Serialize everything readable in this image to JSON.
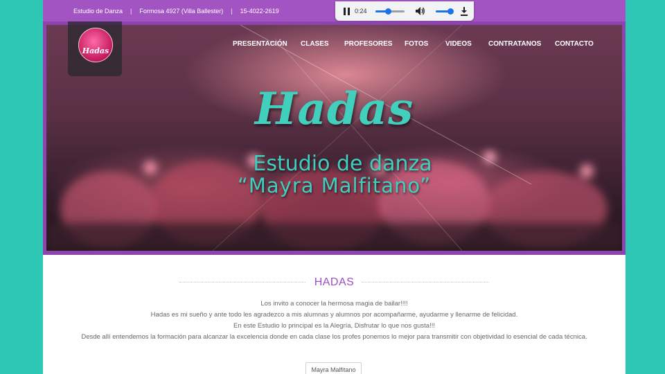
{
  "topbar": {
    "studio": "Estudio de Danza",
    "address": "Formosa 4927 (Villa Ballester)",
    "phone": "15-4022-2619",
    "separator": "|"
  },
  "audio_player": {
    "time": "0:24",
    "progress_fraction": 0.45,
    "volume_fraction": 1.0,
    "pause_icon": "pause-icon",
    "volume_icon": "volume-icon",
    "download_icon": "download-icon"
  },
  "logo": {
    "text": "Hadas"
  },
  "nav": {
    "items": [
      "PRESENTACIÓN",
      "CLASES",
      "PROFESORES",
      "FOTOS",
      "VIDEOS",
      "CONTRATANOS",
      "CONTACTO"
    ]
  },
  "hero": {
    "title": "Hadas",
    "subtitle_line1": "Estudio de danza",
    "subtitle_line2": "“Mayra Malfitano”"
  },
  "section": {
    "title": "HADAS",
    "paragraphs": [
      "Los invito a conocer la hermosa magia de bailar!!!!",
      "Hadas es mi sueño y ante todo les agradezco a mis alumnas y alumnos por acompañarme, ayudarme y llenarme de felicidad.",
      "En este Estudio lo principal es la Alegría, Disfrutar lo que nos gusta!!!",
      "Desde allí entendemos la formación para alcanzar la excelencia donde en cada clase los profes ponemos lo mejor para transmitir con objetividad lo esencial de cada técnica."
    ],
    "button_label": "Mayra Malfitano"
  },
  "colors": {
    "background": "#2ec7b6",
    "purple": "#a254c2",
    "turquoise": "#41d0bd"
  }
}
